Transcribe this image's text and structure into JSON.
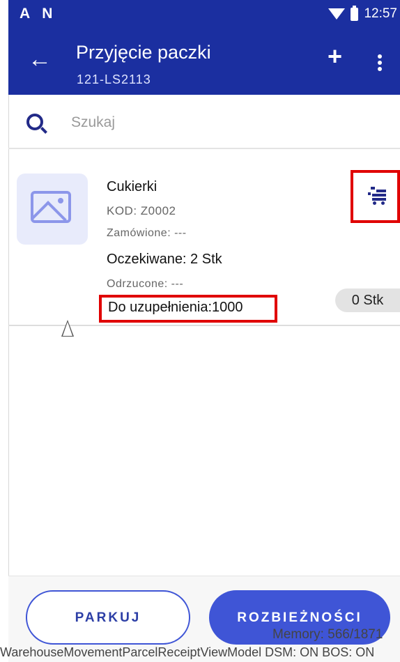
{
  "status_bar": {
    "left_icons": "A N",
    "time": "12:57"
  },
  "app_bar": {
    "back_icon": "arrow-left-icon",
    "title": "Przyjęcie paczki",
    "subtitle": "121-LS2113",
    "add_icon": "+"
  },
  "search": {
    "placeholder": "Szukaj"
  },
  "item": {
    "name": "Cukierki",
    "code": "KOD: Z0002",
    "ordered": "Zamówione: ---",
    "expected": "Oczekiwane: 2 Stk",
    "rejected": "Odrzucone: ---",
    "to_fill": "Do uzupełnienia:1000",
    "quantity_chip": "0 Stk",
    "cart_icon": "cart-icon"
  },
  "buttons": {
    "park": "PARKUJ",
    "discrepancies": "ROZBIEŻNOŚCI"
  },
  "debug": {
    "memory": "Memory: 566/1871",
    "footer": "WarehouseMovementParcelReceiptViewModel DSM: ON BOS: ON"
  },
  "colors": {
    "primary": "#1b2fa0",
    "accent": "#3f55d6",
    "highlight": "#e00000"
  }
}
